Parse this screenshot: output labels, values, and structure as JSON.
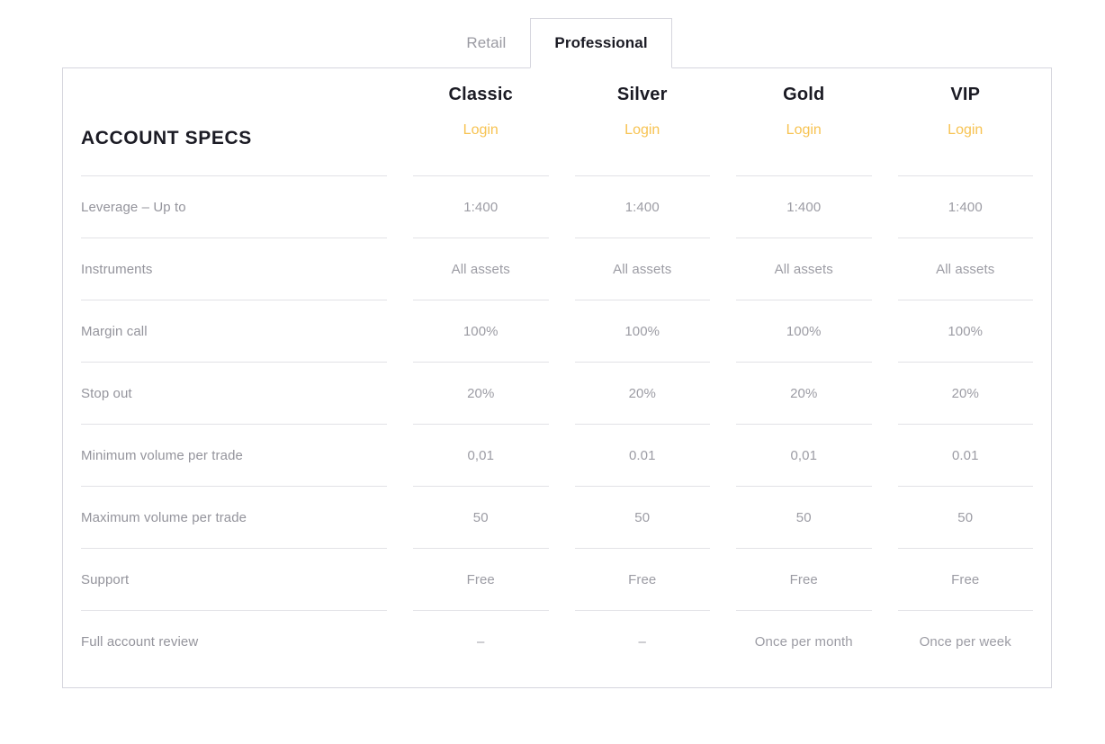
{
  "tabs": [
    {
      "label": "Retail",
      "active": false
    },
    {
      "label": "Professional",
      "active": true
    }
  ],
  "table": {
    "title": "ACCOUNT SPECS",
    "login_label": "Login",
    "plans": [
      "Classic",
      "Silver",
      "Gold",
      "VIP"
    ],
    "rows": [
      {
        "label": "Leverage – Up to",
        "values": [
          "1:400",
          "1:400",
          "1:400",
          "1:400"
        ]
      },
      {
        "label": "Instruments",
        "values": [
          "All assets",
          "All assets",
          "All assets",
          "All assets"
        ]
      },
      {
        "label": "Margin call",
        "values": [
          "100%",
          "100%",
          "100%",
          "100%"
        ]
      },
      {
        "label": "Stop out",
        "values": [
          "20%",
          "20%",
          "20%",
          "20%"
        ]
      },
      {
        "label": "Minimum volume per trade",
        "values": [
          "0,01",
          "0.01",
          "0,01",
          "0.01"
        ]
      },
      {
        "label": "Maximum volume per trade",
        "values": [
          "50",
          "50",
          "50",
          "50"
        ]
      },
      {
        "label": "Support",
        "values": [
          "Free",
          "Free",
          "Free",
          "Free"
        ]
      },
      {
        "label": "Full account review",
        "values": [
          "–",
          "–",
          "Once per month",
          "Once per week"
        ]
      }
    ]
  },
  "colors": {
    "accent": "#f7c352",
    "heading": "#1b1b24",
    "muted": "#9c9ca4",
    "border": "#d6d6de",
    "separator": "#e2e2e6"
  }
}
